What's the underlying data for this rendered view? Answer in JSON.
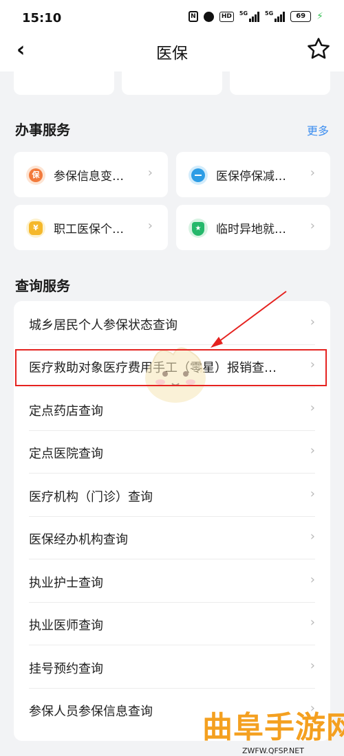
{
  "status_bar": {
    "time": "15:10",
    "nfc_label": "N",
    "hd_label": "HD",
    "signal1_label": "5G",
    "signal2_label": "5G",
    "battery": "69"
  },
  "nav": {
    "title": "医保",
    "back_icon": "chevron-left-icon",
    "favorite_icon": "star-outline-icon"
  },
  "handle_section": {
    "title": "办事服务",
    "more_label": "更多",
    "tiles": [
      {
        "label": "参保信息变…",
        "icon": "insurance-badge-icon",
        "icon_glyph": "保",
        "color": "#f27a3c"
      },
      {
        "label": "医保停保减…",
        "icon": "minus-circle-icon",
        "icon_glyph": "",
        "color": "#2d9de5"
      },
      {
        "label": "职工医保个…",
        "icon": "money-bag-icon",
        "icon_glyph": "¥",
        "color": "#f5b82b"
      },
      {
        "label": "临时异地就…",
        "icon": "shield-icon",
        "icon_glyph": "★",
        "color": "#25b86b"
      }
    ]
  },
  "query_section": {
    "title": "查询服务",
    "items": [
      {
        "label": "城乡居民个人参保状态查询"
      },
      {
        "label": "医疗救助对象医疗费用手工（零星）报销查…"
      },
      {
        "label": "定点药店查询"
      },
      {
        "label": "定点医院查询"
      },
      {
        "label": "医疗机构（门诊）查询"
      },
      {
        "label": "医保经办机构查询"
      },
      {
        "label": "执业护士查询"
      },
      {
        "label": "执业医师查询"
      },
      {
        "label": "挂号预约查询"
      },
      {
        "label": "参保人员参保信息查询"
      }
    ]
  },
  "annotation": {
    "highlight_color": "#e5221f"
  },
  "watermark": {
    "text": "曲阜手游网",
    "url": "ZWFW.QFSP.NET"
  }
}
